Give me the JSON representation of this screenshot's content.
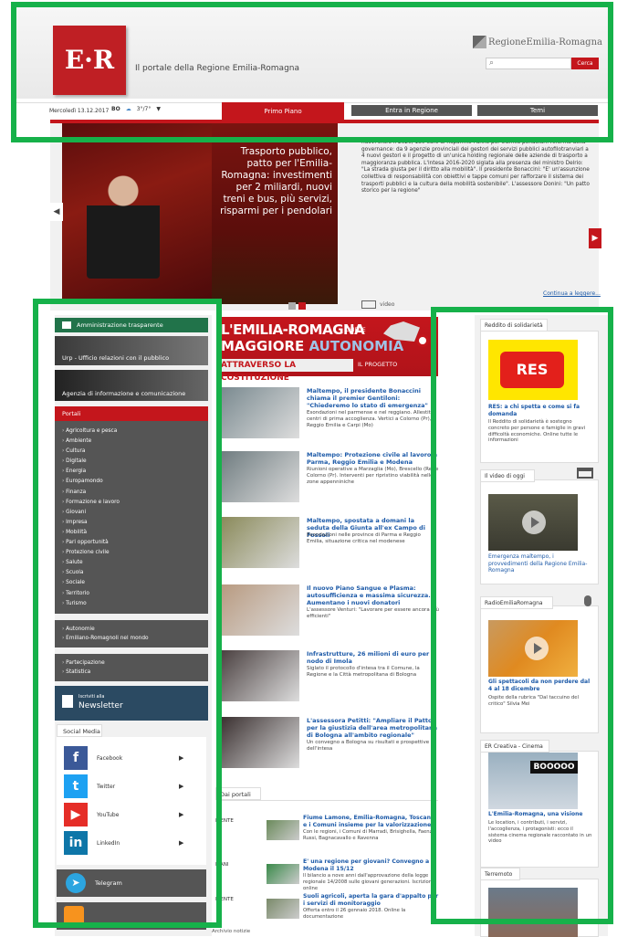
{
  "header": {
    "logo_text": "E·R",
    "tagline": "Il portale della Regione Emilia-Romagna",
    "region_mark": "RegioneEmilia-Romagna",
    "search_placeholder": "",
    "search_button": "Cerca",
    "date": "Mercoledì 13.12.2017",
    "weather_city": "BO",
    "temperature": "3°/7°",
    "tabs": [
      "Primo Piano",
      "Entra in Regione",
      "Temi"
    ]
  },
  "hero": {
    "title": "Trasporto pubblico, patto per l'Emilia-Romagna: investimenti per 2 miliardi, nuovi treni e bus, più servizi, risparmi per i pendolari",
    "text": "nuovi entro il 2020, 180 euro di risparmio l'anno per 3Gmila pendolari. Riforma della governance: da 9 agenzie provinciali dei gestori dei servizi pubblici autofilotranviari a 4 nuovi gestori e il progetto di un'unica holding regionale delle aziende di trasporto a maggioranza pubblica. L'intesa 2016-2020 siglata alla presenza del ministro Delrio: \"La strada giusta per il diritto alla mobilità\". Il presidente Bonaccini: \"E' un'assunzione collettiva di responsabilità con obiettivi e tappe comuni per rafforzare il sistema dei trasporti pubblici e la cultura della mobilità sostenibile\". L'assessore Donini: \"Un patto storico per la regione\"",
    "video_label": "video",
    "continue_link": "Continua a leggere..."
  },
  "left": {
    "amministrazione": "Amministrazione trasparente",
    "urp": "Urp - Ufficio relazioni con il pubblico",
    "agenzia": "Agenzia di informazione e comunicazione",
    "portali_title": "Portali",
    "portali": [
      "Agricoltura e pesca",
      "Ambiente",
      "Cultura",
      "Digitale",
      "Energia",
      "Europamondo",
      "Finanza",
      "Formazione e lavoro",
      "Giovani",
      "Impresa",
      "Mobilità",
      "Pari opportunità",
      "Protezione civile",
      "Salute",
      "Scuola",
      "Sociale",
      "Territorio",
      "Turismo"
    ],
    "box2": [
      "Autonomie",
      "Emiliano-Romagnoli nel mondo"
    ],
    "box3": [
      "Partecipazione",
      "Statistica"
    ],
    "newsletter_small": "Iscriviti alla",
    "newsletter_big": "Newsletter",
    "social_title": "Social Media",
    "social": [
      {
        "name": "Facebook",
        "color": "#3b5998",
        "glyph": "f"
      },
      {
        "name": "Twitter",
        "color": "#1da1f2",
        "glyph": "t"
      },
      {
        "name": "YouTube",
        "color": "#e52d27",
        "glyph": "▶"
      },
      {
        "name": "LinkedIn",
        "color": "#0e76a8",
        "glyph": "in"
      }
    ],
    "telegram": "Telegram"
  },
  "banner": {
    "line1": "L'EMILIA-ROMAGNA",
    "chiede": "CHIEDE",
    "line2a": "MAGGIORE",
    "line2b": "AUTONOMIA",
    "line3": "ATTRAVERSO LA COSTITUZIONE",
    "progetto": "IL PROGETTO"
  },
  "news": [
    {
      "title": "Maltempo, il presidente Bonaccini chiama il premier Gentiloni: \"Chiederemo lo stato di emergenza\"",
      "desc": "Esondazioni nel parmense e nel reggiano. Allestiti centri di prima accoglienza. Vertici a Colorno (Pr), Reggio Emilia e Carpi (Mo)",
      "color": "#7a8a90"
    },
    {
      "title": "Maltempo: Protezione civile al lavoro a Parma, Reggio Emilia e Modena",
      "desc": "Riunioni operative a Marzaglia (Mo), Brescello (Re) e Colorno (Pr). Interventi per ripristino viabilità nelle zone appenniniche",
      "color": "#6f7c80"
    },
    {
      "title": "Maltempo, spostata a domani la seduta della Giunta all'ex Campo di Fossoli",
      "desc": "Esondazioni nelle province di Parma e Reggio Emilia, situazione critica nel modenese",
      "color": "#8a8a5a"
    },
    {
      "title": "Il nuovo Piano Sangue e Plasma: autosufficienza e massima sicurezza. Aumentano i nuovi donatori",
      "desc": "L'assessore Venturi: \"Lavorare per essere ancora più efficienti\"",
      "color": "#b89a80"
    },
    {
      "title": "Infrastrutture, 26 milioni di euro per il nodo di Imola",
      "desc": "Siglato il protocollo d'intesa tra il Comune, la Regione e la Città metropolitana di Bologna",
      "color": "#4a4040"
    },
    {
      "title": "L'assessora Petitti: \"Ampliare il Patto per la giustizia dell'area metropolitana di Bologna all'ambito regionale\"",
      "desc": "Un convegno a Bologna su risultati e prospettive dell'intesa",
      "color": "#3a3030"
    }
  ],
  "portali_section": {
    "title": "Dai portali",
    "rows": [
      {
        "cat": "BIENTE",
        "title": "Fiume Lamone, Emilia-Romagna, Toscana e i Comuni insieme per la valorizzazione",
        "desc": "Con le regioni, i Comuni di Marradi, Brisighella, Faenza, Russi, Bagnacavallo e Ravenna",
        "color": "#6a8a5a"
      },
      {
        "cat": "IVANI",
        "title": "E' una regione per giovani? Convegno a Modena il 15/12",
        "desc": "Il bilancio a nove anni dall'approvazione della legge regionale 14/2008 sulle giovani generazioni. Iscrizioni online",
        "color": "#3a8a4a"
      },
      {
        "cat": "BIENTE",
        "title": "Suoli agricoli, aperta la gara d'appalto per i servizi di monitoraggio",
        "desc": "Offerta entro il 26 gennaio 2018. Online la documentazione",
        "color": "#7a8a6a"
      }
    ],
    "archive": "Archivio notizie"
  },
  "right": {
    "res_hdr": "Reddito di solidarietà",
    "res_logo": "RES",
    "res_title": "RES: a chi spetta e come si fa domanda",
    "res_desc": "Il Reddito di solidarietà è sostegno concreto per persone e famiglie in gravi difficoltà economiche. Online tutte le informazioni",
    "video_hdr": "Il video di oggi",
    "video_title": "Emergenza maltempo, i provvedimenti della Regione Emilia-Romagna",
    "radio_hdr": "RadioEmiliaRomagna",
    "radio_title": "Gli spettacoli da non perdere dal 4 al 18 dicembre",
    "radio_desc": "Ospite della rubrica \"Dal taccuino del critico\" Silvia Mei",
    "cinema_hdr": "ER Creativa - Cinema",
    "cinema_sign": "BOOOOO",
    "cinema_title": "L'Emilia-Romagna, una visione",
    "cinema_desc": "Le location, i contributi, i servizi, l'accoglienza, i protagonisti: ecco il sistema cinema regionale raccontato in un video",
    "terremoto_hdr": "Terremoto"
  }
}
